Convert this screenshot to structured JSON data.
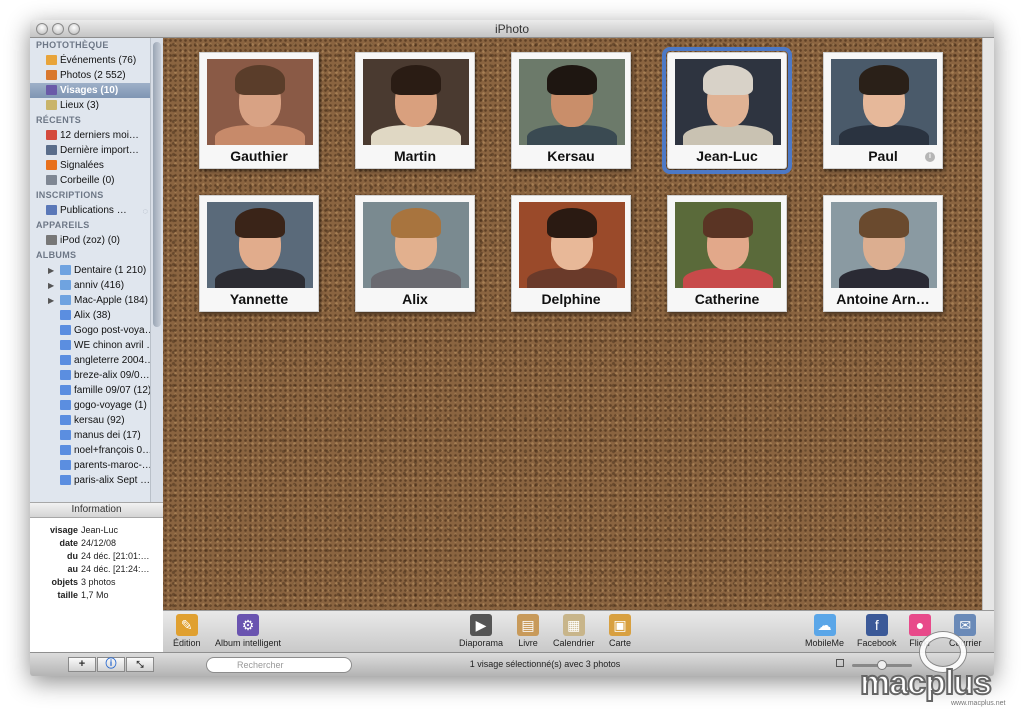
{
  "window": {
    "title": "iPhoto"
  },
  "sidebar": {
    "sections": [
      {
        "title": "PHOTOTHÈQUE",
        "items": [
          {
            "label": "Événements (76)",
            "icon": "events-icon",
            "color": "#e8a43a"
          },
          {
            "label": "Photos (2 552)",
            "icon": "photos-icon",
            "color": "#d9782e"
          },
          {
            "label": "Visages (10)",
            "icon": "faces-icon",
            "color": "#6a5aa8",
            "selected": true
          },
          {
            "label": "Lieux (3)",
            "icon": "places-icon",
            "color": "#c9b46a"
          }
        ]
      },
      {
        "title": "RÉCENTS",
        "items": [
          {
            "label": "12 derniers moi…",
            "icon": "calendar-icon",
            "color": "#d44a3c"
          },
          {
            "label": "Dernière import…",
            "icon": "import-icon",
            "color": "#5a6d8a"
          },
          {
            "label": "Signalées",
            "icon": "flag-icon",
            "color": "#e8701c"
          },
          {
            "label": "Corbeille (0)",
            "icon": "trash-icon",
            "color": "#7f8793"
          }
        ]
      },
      {
        "title": "INSCRIPTIONS",
        "items": [
          {
            "label": "Publications …",
            "icon": "subscription-icon",
            "color": "#5a78b8"
          }
        ]
      },
      {
        "title": "APPAREILS",
        "items": [
          {
            "label": "iPod (zoz) (0)",
            "icon": "ipod-icon",
            "color": "#777777"
          }
        ]
      },
      {
        "title": "ALBUMS",
        "items": [
          {
            "label": "Dentaire (1 210)",
            "icon": "folder-icon",
            "color": "#6fa3e0",
            "folder": true
          },
          {
            "label": "anniv (416)",
            "icon": "folder-icon",
            "color": "#6fa3e0",
            "folder": true
          },
          {
            "label": "Mac-Apple (184)",
            "icon": "folder-icon",
            "color": "#6fa3e0",
            "folder": true
          },
          {
            "label": "Alix (38)",
            "icon": "album-icon",
            "color": "#5b8ee0"
          },
          {
            "label": "Gogo post-voya…",
            "icon": "album-icon",
            "color": "#5b8ee0"
          },
          {
            "label": "WE chinon avril …",
            "icon": "album-icon",
            "color": "#5b8ee0"
          },
          {
            "label": "angleterre 2004…",
            "icon": "album-icon",
            "color": "#5b8ee0"
          },
          {
            "label": "breze-alix 09/0…",
            "icon": "album-icon",
            "color": "#5b8ee0"
          },
          {
            "label": "famille 09/07 (12)",
            "icon": "album-icon",
            "color": "#5b8ee0"
          },
          {
            "label": "gogo-voyage (1)",
            "icon": "album-icon",
            "color": "#5b8ee0"
          },
          {
            "label": "kersau (92)",
            "icon": "album-icon",
            "color": "#5b8ee0"
          },
          {
            "label": "manus dei (17)",
            "icon": "album-icon",
            "color": "#5b8ee0"
          },
          {
            "label": "noel+françois 0…",
            "icon": "album-icon",
            "color": "#5b8ee0"
          },
          {
            "label": "parents-maroc-…",
            "icon": "album-icon",
            "color": "#5b8ee0"
          },
          {
            "label": "paris-alix Sept …",
            "icon": "album-icon",
            "color": "#5b8ee0"
          }
        ]
      }
    ]
  },
  "info": {
    "header": "Information",
    "rows": [
      {
        "key": "visage",
        "value": "Jean-Luc"
      },
      {
        "key": "date",
        "value": "24/12/08"
      },
      {
        "key": "du",
        "value": "24 déc. [21:01:…"
      },
      {
        "key": "au",
        "value": "24 déc. [21:24:…"
      },
      {
        "key": "objets",
        "value": "3 photos"
      },
      {
        "key": "taille",
        "value": "1,7 Mo"
      }
    ]
  },
  "faces": [
    {
      "name": "Gauthier",
      "skin": "#d8a284",
      "hair": "#5a3d2a",
      "bg": "#8a5a46",
      "shirt": "#c78a6a"
    },
    {
      "name": "Martin",
      "skin": "#d9a07e",
      "hair": "#2a1c14",
      "bg": "#4a3a30",
      "shirt": "#e0d8c4"
    },
    {
      "name": "Kersau",
      "skin": "#c98e6a",
      "hair": "#1e1611",
      "bg": "#6c7a6a",
      "shirt": "#3a4a52"
    },
    {
      "name": "Jean-Luc",
      "skin": "#e0b294",
      "hair": "#d8d2c8",
      "bg": "#2e3440",
      "shirt": "#c9c2b2",
      "selected": true
    },
    {
      "name": "Paul",
      "skin": "#e6b89a",
      "hair": "#2a2018",
      "bg": "#4a5a6a",
      "shirt": "#2a3340",
      "info": true
    },
    {
      "name": "Yannette",
      "skin": "#e1ac8c",
      "hair": "#3a2418",
      "bg": "#5a6a7a",
      "shirt": "#2c2c32"
    },
    {
      "name": "Alix",
      "skin": "#e2b08e",
      "hair": "#a8743e",
      "bg": "#7a8a90",
      "shirt": "#6a6a70"
    },
    {
      "name": "Delphine",
      "skin": "#e8b898",
      "hair": "#2a1a12",
      "bg": "#9a4a2a",
      "shirt": "#6a3a2a"
    },
    {
      "name": "Catherine",
      "skin": "#e2a88a",
      "hair": "#5a3424",
      "bg": "#5a6a3a",
      "shirt": "#c84a4a"
    },
    {
      "name": "Antoine Arn…",
      "skin": "#dcae90",
      "hair": "#6a4a2e",
      "bg": "#8a9aa2",
      "shirt": "#2a2a34"
    }
  ],
  "toolbar": {
    "left": [
      {
        "label": "Édition",
        "icon": "pencil-icon",
        "color": "#e0a030"
      },
      {
        "label": "Album intelligent",
        "icon": "smart-album-icon",
        "color": "#6a54b0"
      }
    ],
    "center": [
      {
        "label": "Diaporama",
        "icon": "play-icon",
        "color": "#555555"
      },
      {
        "label": "Livre",
        "icon": "book-icon",
        "color": "#c89a5a"
      },
      {
        "label": "Calendrier",
        "icon": "calendar-icon",
        "color": "#c8b58a"
      },
      {
        "label": "Carte",
        "icon": "card-icon",
        "color": "#d8a040"
      }
    ],
    "right": [
      {
        "label": "MobileMe",
        "icon": "cloud-icon",
        "color": "#5aa6e8"
      },
      {
        "label": "Facebook",
        "icon": "facebook-icon",
        "color": "#3b5998"
      },
      {
        "label": "Flickr",
        "icon": "flickr-icon",
        "color": "#e84a8a"
      },
      {
        "label": "Courrier",
        "icon": "mail-icon",
        "color": "#6a8ab8"
      }
    ]
  },
  "statusbar": {
    "search_placeholder": "Rechercher",
    "status": "1 visage sélectionné(s) avec 3 photos",
    "zoom_level": 0.5
  },
  "watermark": {
    "text": "macplus",
    "url": "www.macplus.net"
  }
}
